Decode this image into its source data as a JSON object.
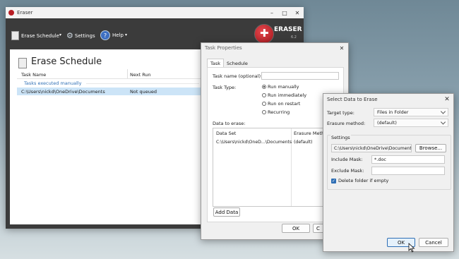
{
  "eraser": {
    "title": "Eraser",
    "toolbar": {
      "erase_schedule": "Erase Schedule",
      "settings": "Settings",
      "help": "Help"
    },
    "logo_text": "ERASER",
    "logo_version": "6.2",
    "heading": "Erase Schedule",
    "columns": [
      "Task Name",
      "Next Run"
    ],
    "group": "Tasks executed manually",
    "rows": [
      {
        "name": "C:\\Users\\nickd\\OneDrive\\Documents",
        "next_run": "Not queued"
      }
    ]
  },
  "task_properties": {
    "title": "Task Properties",
    "tabs": [
      "Task",
      "Schedule"
    ],
    "task_name_label": "Task name (optional):",
    "task_name_value": "",
    "task_type_label": "Task Type:",
    "task_types": [
      "Run manually",
      "Run immediately",
      "Run on restart",
      "Recurring"
    ],
    "selected_type": 0,
    "data_label": "Data to erase:",
    "data_columns": [
      "Data Set",
      "Erasure Method"
    ],
    "data_rows": [
      {
        "set": "C:\\Users\\nickd\\OneD...\\Documents",
        "method": "(default)"
      }
    ],
    "add_data": "Add Data",
    "ok": "OK",
    "cancel": "C"
  },
  "select_data": {
    "title": "Select Data to Erase",
    "target_type_label": "Target type:",
    "target_type_value": "Files in Folder",
    "erasure_method_label": "Erasure method:",
    "erasure_method_value": "(default)",
    "settings_label": "Settings",
    "folder_path": "C:\\Users\\nickd\\OneDrive\\Documents",
    "browse": "Browse...",
    "include_mask_label": "Include Mask:",
    "include_mask_value": "*.doc",
    "exclude_mask_label": "Exclude Mask:",
    "exclude_mask_value": "",
    "delete_folder_label": "Delete folder if empty",
    "delete_folder_checked": true,
    "ok": "OK",
    "cancel": "Cancel"
  },
  "colors": {
    "eraser_toolbar": "#3b3b3b",
    "selection": "#cce4f7",
    "accent": "#2f6fb5",
    "logo_red": "#b81d24"
  }
}
